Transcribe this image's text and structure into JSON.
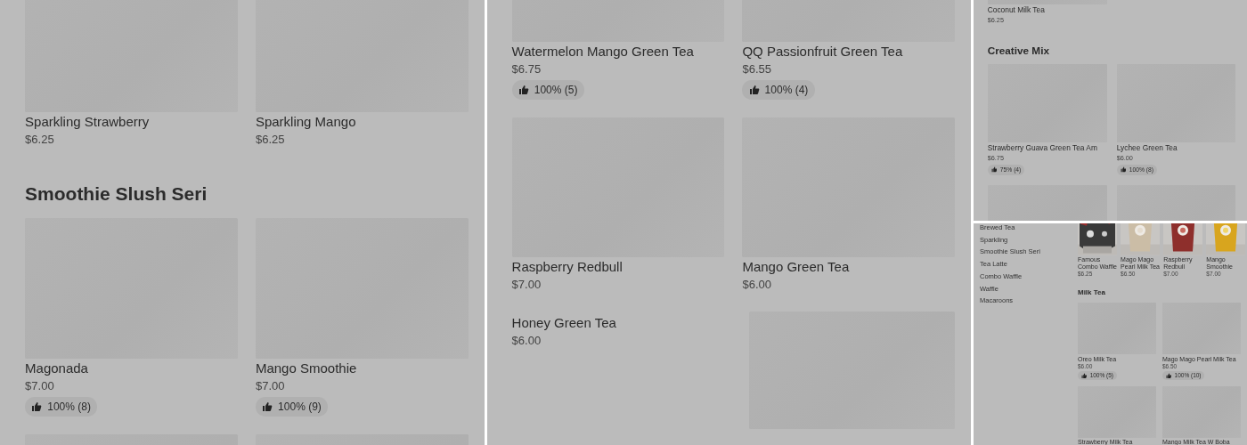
{
  "panels": [
    {
      "kind": "menu",
      "sections": [
        {
          "items": [
            {
              "kind": "card",
              "name": "Sparkling Strawberry",
              "price": "$6.25"
            },
            {
              "kind": "card",
              "name": "Sparkling Mango",
              "price": "$6.25"
            }
          ]
        },
        {
          "title": "Smoothie Slush Seri",
          "items": [
            {
              "kind": "card",
              "name": "Magonada",
              "price": "$7.00",
              "rating": "100% (8)"
            },
            {
              "kind": "card",
              "name": "Mango Smoothie",
              "price": "$7.00",
              "rating": "100% (9)"
            },
            {
              "kind": "card"
            },
            {
              "kind": "card"
            }
          ]
        }
      ]
    },
    {
      "kind": "menu",
      "sections": [
        {
          "items": [
            {
              "kind": "card",
              "name": "Watermelon Mango Green Tea",
              "price": "$6.75",
              "rating": "100% (5)"
            },
            {
              "kind": "card",
              "name": "QQ Passionfruit Green Tea",
              "price": "$6.55",
              "rating": "100% (4)"
            },
            {
              "kind": "card",
              "name": "Raspberry Redbull",
              "price": "$7.00"
            },
            {
              "kind": "card",
              "name": "Mango Green Tea",
              "price": "$6.00"
            },
            {
              "kind": "row",
              "name": "Honey Green Tea",
              "price": "$6.00"
            }
          ]
        }
      ]
    },
    {
      "kind": "menu",
      "sections": [
        {
          "items": [
            {
              "kind": "card",
              "name": "Coconut Milk Tea",
              "price": "$6.25"
            }
          ]
        },
        {
          "title": "Creative Mix",
          "items": [
            {
              "kind": "card",
              "name": "Strawberry Guava Green Tea Am",
              "price": "$6.75",
              "rating": "75% (4)"
            },
            {
              "kind": "card",
              "name": "Lychee Green Tea",
              "price": "$6.00",
              "rating": "100% (8)"
            },
            {
              "kind": "card"
            },
            {
              "kind": "card"
            }
          ]
        }
      ]
    },
    {
      "kind": "store",
      "categories": [
        "Brewed Tea",
        "Sparkling",
        "Smoothie Slush Seri",
        "Tea Latte",
        "Combo Waffle",
        "Waffle",
        "Macaroons"
      ],
      "featured": [
        {
          "name": "Famous Combo Waffle",
          "price": "$6.25"
        },
        {
          "name": "Mago Mago Pearl Milk Tea",
          "price": "$6.50"
        },
        {
          "name": "Raspberry Redbull",
          "price": "$7.00"
        },
        {
          "name": "Mango Smoothie",
          "price": "$7.00"
        }
      ],
      "sections": [
        {
          "title": "Milk Tea",
          "items": [
            {
              "kind": "card",
              "name": "Oreo Milk Tea",
              "price": "$6.00",
              "rating": "100% (5)"
            },
            {
              "kind": "card",
              "name": "Mago Mago Pearl Milk Tea",
              "price": "$6.50",
              "rating": "100% (10)"
            },
            {
              "kind": "card",
              "name": "Strawberry Milk Tea"
            },
            {
              "kind": "card",
              "name": "Mango Milk Tea W Boba"
            }
          ]
        }
      ]
    }
  ]
}
